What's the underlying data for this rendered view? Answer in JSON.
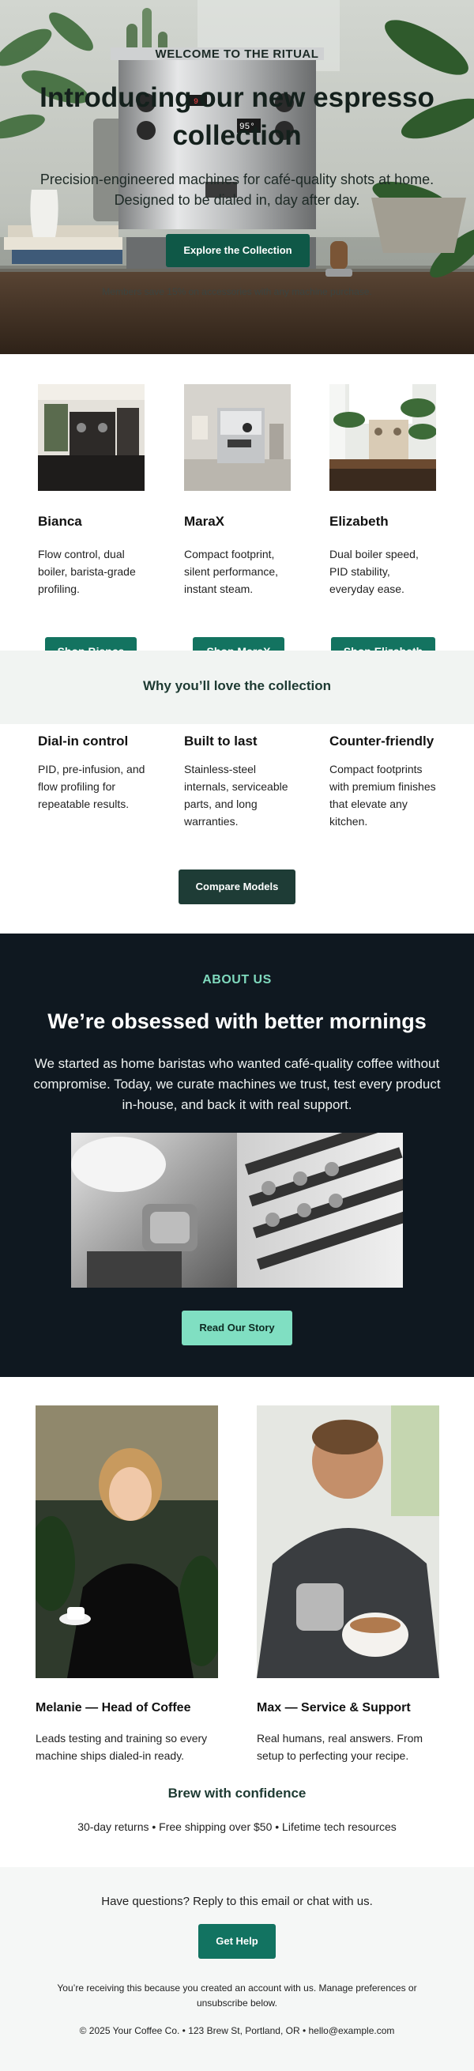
{
  "hero": {
    "eyebrow": "WELCOME TO THE RITUAL",
    "title": "Introducing our new espresso collection",
    "subtitle": "Precision-engineered machines for café-quality shots at home. Designed to be dialed in, day after day.",
    "cta_label": "Explore the Collection",
    "note": "Members save 15% on accessories with any machine purchase.",
    "machine_gauge_left": "9",
    "machine_gauge_right": "95°"
  },
  "products": [
    {
      "name": "Bianca",
      "description": "Flow control, dual boiler, barista-grade profiling.",
      "button_label": "Shop Bianca"
    },
    {
      "name": "MaraX",
      "description": "Compact footprint, silent performance, instant steam.",
      "button_label": "Shop MaraX"
    },
    {
      "name": "Elizabeth",
      "description": "Dual boiler speed, PID stability, everyday ease.",
      "button_label": "Shop Elizabeth"
    }
  ],
  "why": {
    "heading": "Why you’ll love the collection",
    "features": [
      {
        "title": "Dial-in control",
        "description": "PID, pre-infusion, and flow profiling for repeatable results."
      },
      {
        "title": "Built to last",
        "description": "Stainless-steel internals, serviceable parts, and long warranties."
      },
      {
        "title": "Counter-friendly",
        "description": "Compact footprints with premium finishes that elevate any kitchen."
      }
    ],
    "compare_label": "Compare Models"
  },
  "about": {
    "eyebrow": "ABOUT US",
    "heading": "We’re obsessed with better mornings",
    "body": "We started as home baristas who wanted café-quality coffee without compromise. Today, we curate machines we trust, test every product in-house, and back it with real support.",
    "button_label": "Read Our Story"
  },
  "team": [
    {
      "name": "Melanie — Head of Coffee",
      "description": "Leads testing and training so every machine ships dialed-in ready."
    },
    {
      "name": "Max — Service & Support",
      "description": "Real humans, real answers. From setup to perfecting your recipe."
    }
  ],
  "confidence": {
    "heading": "Brew with confidence",
    "perks": "30-day returns • Free shipping over $50 • Lifetime tech resources"
  },
  "footer": {
    "question": "Have questions? Reply to this email or chat with us.",
    "help_label": "Get Help",
    "legal": "You’re receiving this because you created an account with us. Manage preferences or unsubscribe below.",
    "address": "© 2025 Your Coffee Co. • 123 Brew St, Portland, OR • hello@example.com"
  },
  "colors": {
    "primary_green": "#137360",
    "dark_green": "#1e3c36",
    "about_bg": "#0f1820",
    "mint_accent": "#80dfc2",
    "soft_band": "#f1f4f2"
  }
}
